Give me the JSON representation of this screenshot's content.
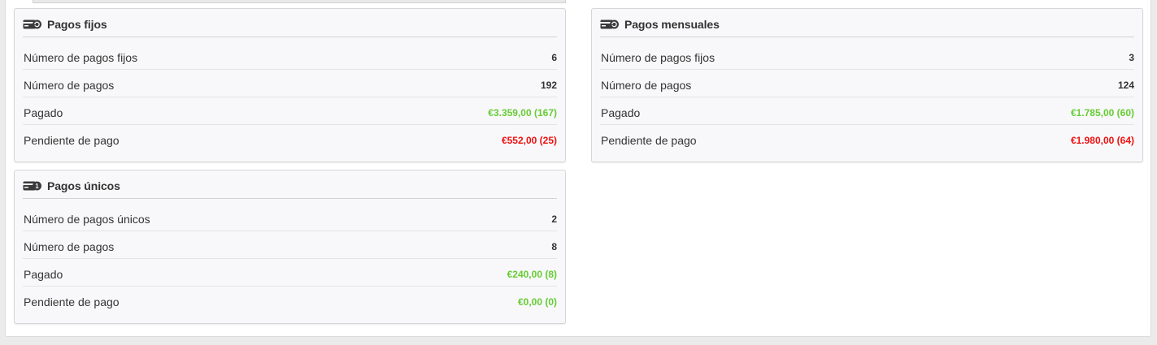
{
  "colors": {
    "paid": "#66cc33",
    "pending": "#ee1111"
  },
  "panels": {
    "fixed": {
      "title": "Pagos fijos",
      "icon": "credit-card-recurring-icon",
      "rows": [
        {
          "label": "Número de pagos fijos",
          "value": "6",
          "status": "neutral"
        },
        {
          "label": "Número de pagos",
          "value": "192",
          "status": "neutral"
        },
        {
          "label": "Pagado",
          "value": "€3.359,00 (167)",
          "status": "paid"
        },
        {
          "label": "Pendiente de pago",
          "value": "€552,00 (25)",
          "status": "pending"
        }
      ]
    },
    "monthly": {
      "title": "Pagos mensuales",
      "icon": "credit-card-recurring-icon",
      "rows": [
        {
          "label": "Número de pagos fijos",
          "value": "3",
          "status": "neutral"
        },
        {
          "label": "Número de pagos",
          "value": "124",
          "status": "neutral"
        },
        {
          "label": "Pagado",
          "value": "€1.785,00 (60)",
          "status": "paid"
        },
        {
          "label": "Pendiente de pago",
          "value": "€1.980,00 (64)",
          "status": "pending"
        }
      ]
    },
    "single": {
      "title": "Pagos únicos",
      "icon": "credit-card-single-icon",
      "rows": [
        {
          "label": "Número de pagos únicos",
          "value": "2",
          "status": "neutral"
        },
        {
          "label": "Número de pagos",
          "value": "8",
          "status": "neutral"
        },
        {
          "label": "Pagado",
          "value": "€240,00 (8)",
          "status": "paid"
        },
        {
          "label": "Pendiente de pago",
          "value": "€0,00 (0)",
          "status": "paid"
        }
      ]
    }
  }
}
